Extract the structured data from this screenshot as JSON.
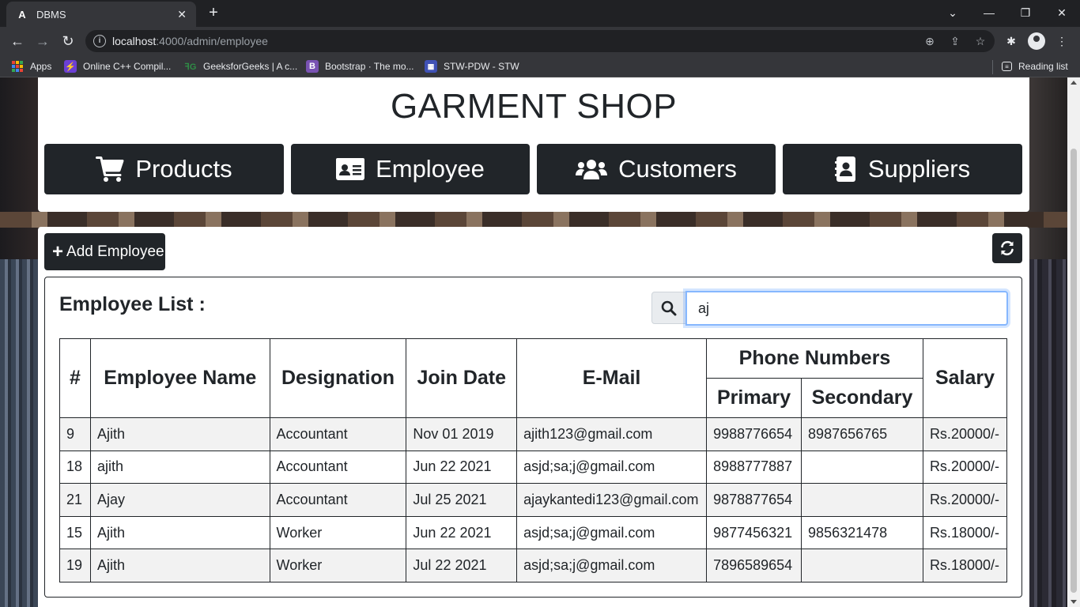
{
  "browser": {
    "tab_title": "DBMS",
    "tab_favicon": "A",
    "url_host": "localhost",
    "url_path": ":4000/admin/employee",
    "bookmarks": [
      {
        "label": "Apps"
      },
      {
        "label": "Online C++ Compil..."
      },
      {
        "label": "GeeksforGeeks | A c..."
      },
      {
        "label": "Bootstrap · The mo..."
      },
      {
        "label": "STW-PDW - STW"
      }
    ],
    "reading_list": "Reading list"
  },
  "header": {
    "title": "GARMENT SHOP",
    "nav": [
      {
        "label": "Products",
        "icon": "shopping-cart-icon"
      },
      {
        "label": "Employee",
        "icon": "id-card-icon"
      },
      {
        "label": "Customers",
        "icon": "users-icon"
      },
      {
        "label": "Suppliers",
        "icon": "address-book-icon"
      }
    ]
  },
  "toolbar": {
    "add_label": "Add Employee",
    "refresh_icon": "refresh-icon"
  },
  "employee_list": {
    "title": "Employee List :",
    "search_value": "aj",
    "columns": {
      "num": "#",
      "name": "Employee Name",
      "designation": "Designation",
      "join_date": "Join Date",
      "email": "E-Mail",
      "phone_group": "Phone Numbers",
      "primary": "Primary",
      "secondary": "Secondary",
      "salary": "Salary"
    },
    "rows": [
      {
        "id": "9",
        "name": "Ajith",
        "designation": "Accountant",
        "join_date": "Nov 01 2019",
        "email": "ajith123@gmail.com",
        "primary": "9988776654",
        "secondary": "8987656765",
        "salary": "Rs.20000/-"
      },
      {
        "id": "18",
        "name": "ajith",
        "designation": "Accountant",
        "join_date": "Jun 22 2021",
        "email": "asjd;sa;j@gmail.com",
        "primary": "8988777887",
        "secondary": "",
        "salary": "Rs.20000/-"
      },
      {
        "id": "21",
        "name": "Ajay",
        "designation": "Accountant",
        "join_date": "Jul 25 2021",
        "email": "ajaykantedi123@gmail.com",
        "primary": "9878877654",
        "secondary": "",
        "salary": "Rs.20000/-"
      },
      {
        "id": "15",
        "name": "Ajith",
        "designation": "Worker",
        "join_date": "Jun 22 2021",
        "email": "asjd;sa;j@gmail.com",
        "primary": "9877456321",
        "secondary": "9856321478",
        "salary": "Rs.18000/-"
      },
      {
        "id": "19",
        "name": "Ajith",
        "designation": "Worker",
        "join_date": "Jul 22 2021",
        "email": "asjd;sa;j@gmail.com",
        "primary": "7896589654",
        "secondary": "",
        "salary": "Rs.18000/-"
      }
    ]
  },
  "colors": {
    "dark_button": "#212529",
    "focus_ring": "#86b7fe",
    "browser_chrome": "#35363a"
  }
}
